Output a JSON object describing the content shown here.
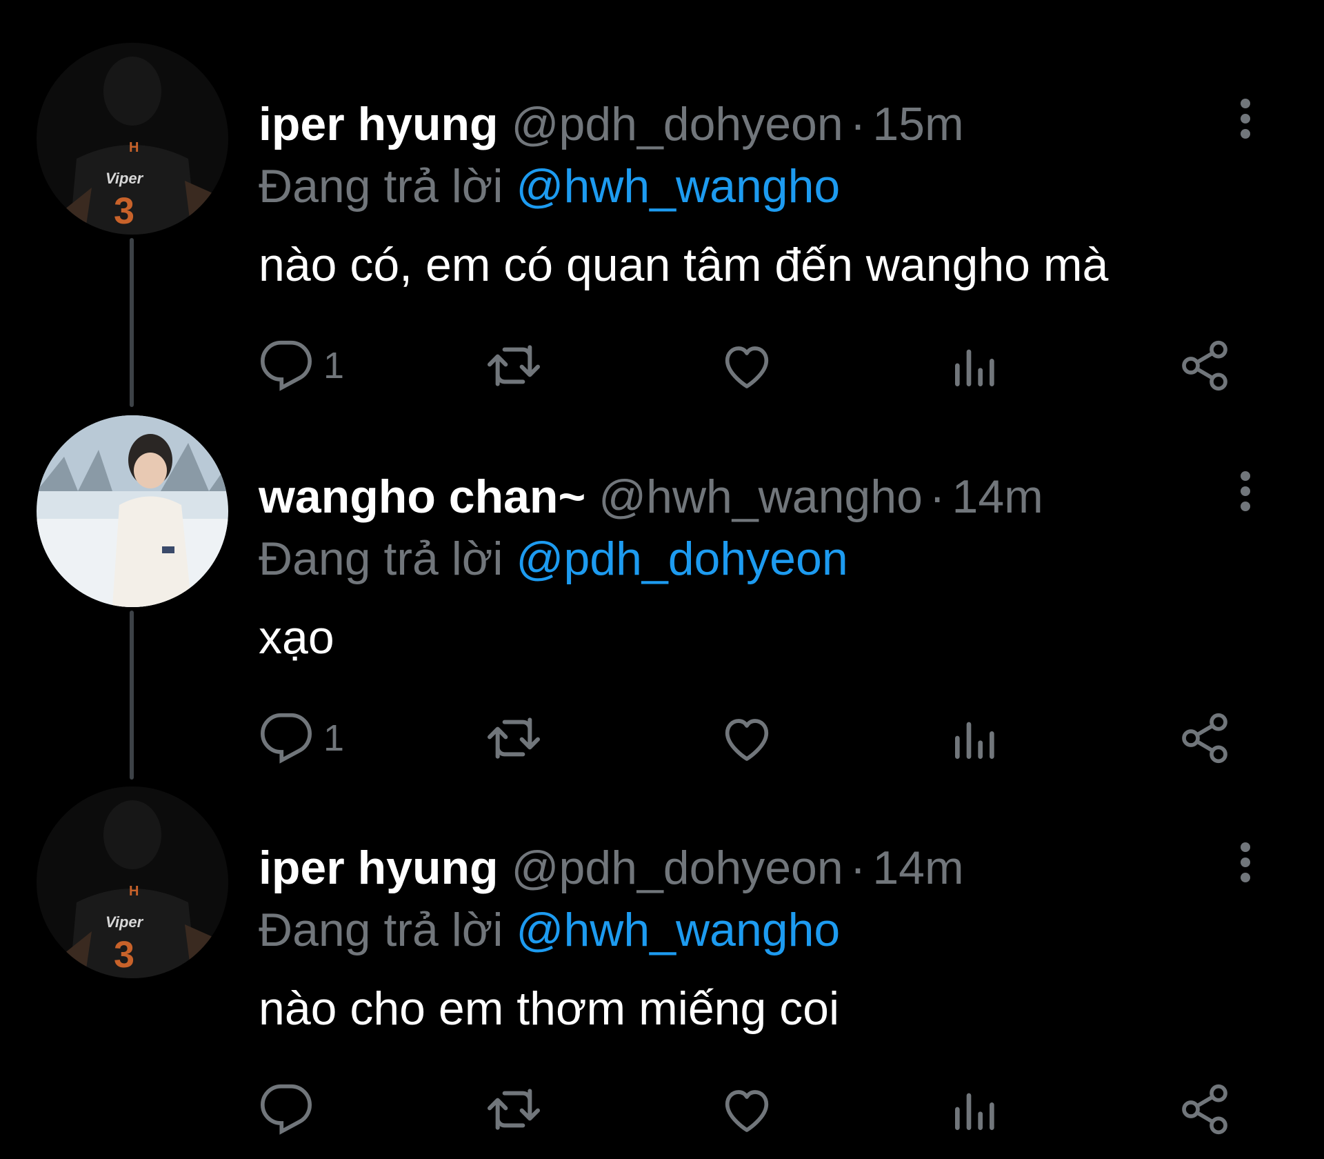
{
  "thread": {
    "tweets": [
      {
        "display_name": "iper hyung",
        "handle": "@pdh_dohyeon",
        "separator": "·",
        "time": "15m",
        "reply_prefix": "Đang trả lời",
        "reply_to": "@hwh_wangho",
        "text": "nào có, em có quan tâm đến wangho mà",
        "reply_count": "1",
        "avatar_jersey_name": "Viper",
        "avatar_jersey_number": "3"
      },
      {
        "display_name": "wangho chan~",
        "handle": "@hwh_wangho",
        "separator": "·",
        "time": "14m",
        "reply_prefix": "Đang trả lời",
        "reply_to": "@pdh_dohyeon",
        "text": "xạo",
        "reply_count": "1"
      },
      {
        "display_name": "iper hyung",
        "handle": "@pdh_dohyeon",
        "separator": "·",
        "time": "14m",
        "reply_prefix": "Đang trả lời",
        "reply_to": "@hwh_wangho",
        "text": "nào cho em thơm miếng coi",
        "reply_count": "",
        "avatar_jersey_name": "Viper",
        "avatar_jersey_number": "3"
      }
    ]
  },
  "colors": {
    "background": "#000000",
    "name": "#ffffff",
    "secondary": "#71767b",
    "mention": "#1d9bf0",
    "thread_line": "#3d4247"
  },
  "icons": {
    "reply": "reply-icon",
    "retweet": "retweet-icon",
    "like": "heart-icon",
    "views": "views-icon",
    "share": "share-icon",
    "more": "more-icon"
  }
}
